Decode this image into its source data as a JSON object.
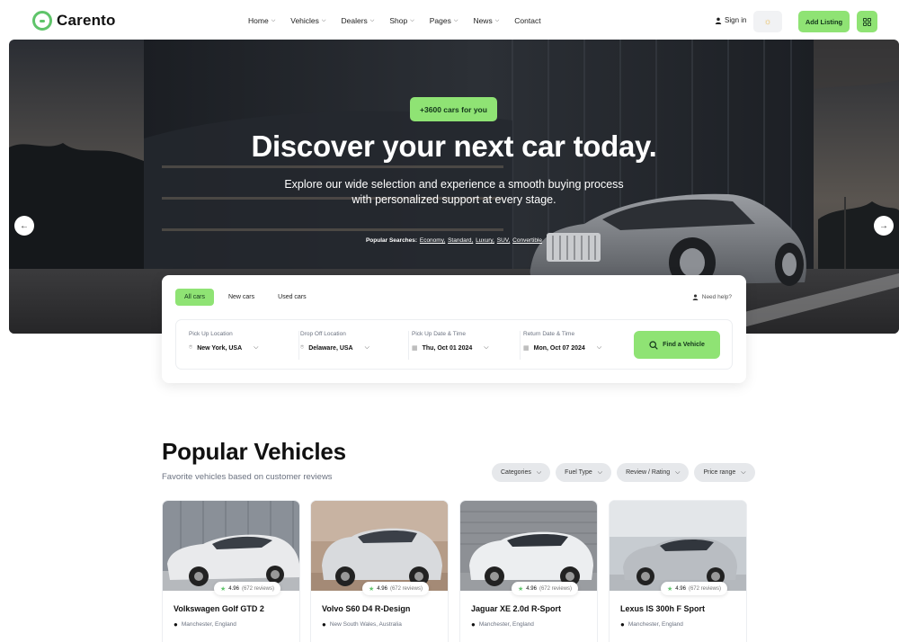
{
  "header": {
    "logo_text": "Carento",
    "nav": [
      {
        "label": "Home",
        "dropdown": true
      },
      {
        "label": "Vehicles",
        "dropdown": true
      },
      {
        "label": "Dealers",
        "dropdown": true
      },
      {
        "label": "Shop",
        "dropdown": true
      },
      {
        "label": "Pages",
        "dropdown": true
      },
      {
        "label": "News",
        "dropdown": true
      },
      {
        "label": "Contact",
        "dropdown": false
      }
    ],
    "sign_in": "Sign in",
    "add_listing": "Add Listing",
    "theme_icon": "sun-icon",
    "menu_icon": "grid-icon"
  },
  "hero": {
    "badge": "+3600 cars for you",
    "title": "Discover your next car today.",
    "subtitle_line1": "Explore our wide selection and experience a smooth buying process",
    "subtitle_line2": "with personalized support at every stage.",
    "popular_label": "Popular Searches:",
    "popular_links": [
      "Economy,",
      "Standard,",
      "Luxury,",
      "SUV,",
      "Convertible"
    ]
  },
  "search": {
    "tabs": [
      {
        "label": "All cars",
        "active": true
      },
      {
        "label": "New cars",
        "active": false
      },
      {
        "label": "Used cars",
        "active": false
      }
    ],
    "need_help": "Need help?",
    "fields": [
      {
        "label": "Pick Up Location",
        "value": "New York, USA",
        "icon": "location-pin-icon"
      },
      {
        "label": "Drop Off Location",
        "value": "Delaware, USA",
        "icon": "location-pin-icon"
      },
      {
        "label": "Pick Up Date & Time",
        "value": "Thu, Oct 01 2024",
        "icon": "calendar-icon"
      },
      {
        "label": "Return Date & Time",
        "value": "Mon, Oct 07 2024",
        "icon": "calendar-icon"
      }
    ],
    "find_button": "Find a Vehicle"
  },
  "popular": {
    "title": "Popular Vehicles",
    "subtitle": "Favorite vehicles based on customer reviews",
    "filters": [
      "Categories",
      "Fuel Type",
      "Review / Rating",
      "Price range"
    ],
    "cards": [
      {
        "name": "Volkswagen Golf GTD 2",
        "location": "Manchester, England",
        "rating": "4.96",
        "reviews": "(672 reviews)",
        "car_color": "#e9eaec",
        "bg": "#8a9098"
      },
      {
        "name": "Volvo S60 D4 R-Design",
        "location": "New South Wales, Australia",
        "rating": "4.96",
        "reviews": "(672 reviews)",
        "car_color": "#d8dadd",
        "bg": "#b59c88"
      },
      {
        "name": "Jaguar XE 2.0d R-Sport",
        "location": "Manchester, England",
        "rating": "4.96",
        "reviews": "(672 reviews)",
        "car_color": "#eceef0",
        "bg": "#8d9095"
      },
      {
        "name": "Lexus IS 300h F Sport",
        "location": "Manchester, England",
        "rating": "4.96",
        "reviews": "(672 reviews)",
        "car_color": "#b9bdc2",
        "bg": "#c7ccd1"
      }
    ]
  },
  "colors": {
    "accent": "#8fe374",
    "accent_text": "#13361b",
    "logo": "#5fc46a"
  }
}
